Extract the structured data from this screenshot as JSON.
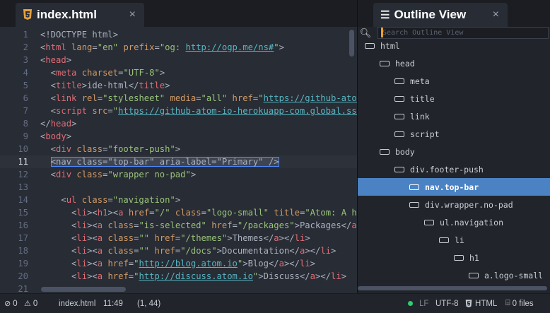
{
  "left_tab": {
    "title": "index.html",
    "icon": "html5-icon",
    "close": "×"
  },
  "right_tab": {
    "title": "Outline View",
    "icon": "list-icon",
    "close": "×"
  },
  "outline": {
    "search_placeholder": "Search Outline View",
    "nodes": [
      {
        "label": "html",
        "depth": 0
      },
      {
        "label": "head",
        "depth": 1
      },
      {
        "label": "meta",
        "depth": 2
      },
      {
        "label": "title",
        "depth": 2
      },
      {
        "label": "link",
        "depth": 2
      },
      {
        "label": "script",
        "depth": 2
      },
      {
        "label": "body",
        "depth": 1
      },
      {
        "label": "div.footer-push",
        "depth": 2
      },
      {
        "label": "nav.top-bar",
        "depth": 3,
        "selected": true
      },
      {
        "label": "div.wrapper.no-pad",
        "depth": 3
      },
      {
        "label": "ul.navigation",
        "depth": 4
      },
      {
        "label": "li",
        "depth": 5
      },
      {
        "label": "h1",
        "depth": 6
      },
      {
        "label": "a.logo-small",
        "depth": 7
      }
    ]
  },
  "editor": {
    "cursor_line": 11,
    "lines": [
      {
        "n": "1",
        "tokens": [
          [
            "pun",
            "<!DOCTYPE html>"
          ]
        ]
      },
      {
        "n": "2",
        "tokens": [
          [
            "pun",
            "<"
          ],
          [
            "tag",
            "html"
          ],
          [
            "pun",
            " "
          ],
          [
            "attr",
            "lang"
          ],
          [
            "pun",
            "="
          ],
          [
            "str",
            "\"en\""
          ],
          [
            "pun",
            " "
          ],
          [
            "attr",
            "prefix"
          ],
          [
            "pun",
            "="
          ],
          [
            "str",
            "\"og: "
          ],
          [
            "link",
            "http://ogp.me/ns#"
          ],
          [
            "str",
            "\""
          ],
          [
            "pun",
            ">"
          ]
        ]
      },
      {
        "n": "3",
        "tokens": [
          [
            "pun",
            "<"
          ],
          [
            "tag",
            "head"
          ],
          [
            "pun",
            ">"
          ]
        ]
      },
      {
        "n": "4",
        "tokens": [
          [
            "pun",
            "  <"
          ],
          [
            "tag",
            "meta"
          ],
          [
            "pun",
            " "
          ],
          [
            "attr",
            "charset"
          ],
          [
            "pun",
            "="
          ],
          [
            "str",
            "\"UTF-8\""
          ],
          [
            "pun",
            ">"
          ]
        ]
      },
      {
        "n": "5",
        "tokens": [
          [
            "pun",
            "  <"
          ],
          [
            "tag",
            "title"
          ],
          [
            "pun",
            ">ide-html</"
          ],
          [
            "tag",
            "title"
          ],
          [
            "pun",
            ">"
          ]
        ]
      },
      {
        "n": "6",
        "tokens": [
          [
            "pun",
            "  <"
          ],
          [
            "tag",
            "link"
          ],
          [
            "pun",
            " "
          ],
          [
            "attr",
            "rel"
          ],
          [
            "pun",
            "="
          ],
          [
            "str",
            "\"stylesheet\""
          ],
          [
            "pun",
            " "
          ],
          [
            "attr",
            "media"
          ],
          [
            "pun",
            "="
          ],
          [
            "str",
            "\"all\""
          ],
          [
            "pun",
            " "
          ],
          [
            "attr",
            "href"
          ],
          [
            "pun",
            "="
          ],
          [
            "str",
            "\""
          ],
          [
            "link",
            "https://github-atom-io"
          ]
        ]
      },
      {
        "n": "7",
        "tokens": [
          [
            "pun",
            "  <"
          ],
          [
            "tag",
            "script"
          ],
          [
            "pun",
            " "
          ],
          [
            "attr",
            "src"
          ],
          [
            "pun",
            "="
          ],
          [
            "str",
            "\""
          ],
          [
            "link",
            "https://github-atom-io-herokuapp-com.global.ssl"
          ]
        ]
      },
      {
        "n": "8",
        "tokens": [
          [
            "pun",
            "</"
          ],
          [
            "tag",
            "head"
          ],
          [
            "pun",
            ">"
          ]
        ]
      },
      {
        "n": "9",
        "tokens": [
          [
            "pun",
            "<"
          ],
          [
            "tag",
            "body"
          ],
          [
            "pun",
            ">"
          ]
        ]
      },
      {
        "n": "10",
        "tokens": [
          [
            "pun",
            "  <"
          ],
          [
            "tag",
            "div"
          ],
          [
            "pun",
            " "
          ],
          [
            "attr",
            "class"
          ],
          [
            "pun",
            "="
          ],
          [
            "str",
            "\"footer-push\""
          ],
          [
            "pun",
            ">"
          ]
        ]
      },
      {
        "n": "11",
        "tokens": [
          [
            "pun",
            "  "
          ],
          [
            "sel",
            "<nav class=\"top-bar\" aria-label=\"Primary\" />"
          ]
        ]
      },
      {
        "n": "12",
        "tokens": [
          [
            "pun",
            "  <"
          ],
          [
            "tag",
            "div"
          ],
          [
            "pun",
            " "
          ],
          [
            "attr",
            "class"
          ],
          [
            "pun",
            "="
          ],
          [
            "str",
            "\"wrapper no-pad\""
          ],
          [
            "pun",
            ">"
          ]
        ]
      },
      {
        "n": "13",
        "tokens": [
          [
            "pun",
            ""
          ]
        ]
      },
      {
        "n": "14",
        "tokens": [
          [
            "pun",
            "    <"
          ],
          [
            "tag",
            "ul"
          ],
          [
            "pun",
            " "
          ],
          [
            "attr",
            "class"
          ],
          [
            "pun",
            "="
          ],
          [
            "str",
            "\"navigation\""
          ],
          [
            "pun",
            ">"
          ]
        ]
      },
      {
        "n": "15",
        "tokens": [
          [
            "pun",
            "      <"
          ],
          [
            "tag",
            "li"
          ],
          [
            "pun",
            "><"
          ],
          [
            "tag",
            "h1"
          ],
          [
            "pun",
            "><"
          ],
          [
            "tag",
            "a"
          ],
          [
            "pun",
            " "
          ],
          [
            "attr",
            "href"
          ],
          [
            "pun",
            "="
          ],
          [
            "str",
            "\"/\""
          ],
          [
            "pun",
            " "
          ],
          [
            "attr",
            "class"
          ],
          [
            "pun",
            "="
          ],
          [
            "str",
            "\"logo-small\""
          ],
          [
            "pun",
            " "
          ],
          [
            "attr",
            "title"
          ],
          [
            "pun",
            "="
          ],
          [
            "str",
            "\"Atom: A h"
          ]
        ]
      },
      {
        "n": "16",
        "tokens": [
          [
            "pun",
            "      <"
          ],
          [
            "tag",
            "li"
          ],
          [
            "pun",
            "><"
          ],
          [
            "tag",
            "a"
          ],
          [
            "pun",
            " "
          ],
          [
            "attr",
            "class"
          ],
          [
            "pun",
            "="
          ],
          [
            "str",
            "\"is-selected\""
          ],
          [
            "pun",
            " "
          ],
          [
            "attr",
            "href"
          ],
          [
            "pun",
            "="
          ],
          [
            "str",
            "\"/packages\""
          ],
          [
            "pun",
            ">Packages</"
          ],
          [
            "tag",
            "a"
          ],
          [
            "pun",
            ">"
          ]
        ]
      },
      {
        "n": "17",
        "tokens": [
          [
            "pun",
            "      <"
          ],
          [
            "tag",
            "li"
          ],
          [
            "pun",
            "><"
          ],
          [
            "tag",
            "a"
          ],
          [
            "pun",
            " "
          ],
          [
            "attr",
            "class"
          ],
          [
            "pun",
            "="
          ],
          [
            "str",
            "\"\""
          ],
          [
            "pun",
            " "
          ],
          [
            "attr",
            "href"
          ],
          [
            "pun",
            "="
          ],
          [
            "str",
            "\"/themes\""
          ],
          [
            "pun",
            ">Themes</"
          ],
          [
            "tag",
            "a"
          ],
          [
            "pun",
            "></"
          ],
          [
            "tag",
            "li"
          ],
          [
            "pun",
            ">"
          ]
        ]
      },
      {
        "n": "18",
        "tokens": [
          [
            "pun",
            "      <"
          ],
          [
            "tag",
            "li"
          ],
          [
            "pun",
            "><"
          ],
          [
            "tag",
            "a"
          ],
          [
            "pun",
            " "
          ],
          [
            "attr",
            "class"
          ],
          [
            "pun",
            "="
          ],
          [
            "str",
            "\"\""
          ],
          [
            "pun",
            " "
          ],
          [
            "attr",
            "href"
          ],
          [
            "pun",
            "="
          ],
          [
            "str",
            "\"/docs\""
          ],
          [
            "pun",
            ">Documentation</"
          ],
          [
            "tag",
            "a"
          ],
          [
            "pun",
            "></"
          ],
          [
            "tag",
            "li"
          ],
          [
            "pun",
            ">"
          ]
        ]
      },
      {
        "n": "19",
        "tokens": [
          [
            "pun",
            "      <"
          ],
          [
            "tag",
            "li"
          ],
          [
            "pun",
            "><"
          ],
          [
            "tag",
            "a"
          ],
          [
            "pun",
            " "
          ],
          [
            "attr",
            "href"
          ],
          [
            "pun",
            "="
          ],
          [
            "str",
            "\""
          ],
          [
            "link",
            "http://blog.atom.io"
          ],
          [
            "str",
            "\""
          ],
          [
            "pun",
            ">Blog</"
          ],
          [
            "tag",
            "a"
          ],
          [
            "pun",
            "></"
          ],
          [
            "tag",
            "li"
          ],
          [
            "pun",
            ">"
          ]
        ]
      },
      {
        "n": "20",
        "tokens": [
          [
            "pun",
            "      <"
          ],
          [
            "tag",
            "li"
          ],
          [
            "pun",
            "><"
          ],
          [
            "tag",
            "a"
          ],
          [
            "pun",
            " "
          ],
          [
            "attr",
            "href"
          ],
          [
            "pun",
            "="
          ],
          [
            "str",
            "\""
          ],
          [
            "link",
            "http://discuss.atom.io"
          ],
          [
            "str",
            "\""
          ],
          [
            "pun",
            ">Discuss</"
          ],
          [
            "tag",
            "a"
          ],
          [
            "pun",
            "></"
          ],
          [
            "tag",
            "li"
          ],
          [
            "pun",
            ">"
          ]
        ]
      },
      {
        "n": "21",
        "tokens": [
          [
            "pun",
            ""
          ]
        ]
      }
    ]
  },
  "status": {
    "errors": "0",
    "warnings": "0",
    "file": "index.html",
    "cursor_pos": "11:49",
    "selection": "(1, 44)",
    "line_ending": "LF",
    "encoding": "UTF-8",
    "grammar": "HTML",
    "files": "0 files",
    "dot_color": "#2ecc71"
  }
}
